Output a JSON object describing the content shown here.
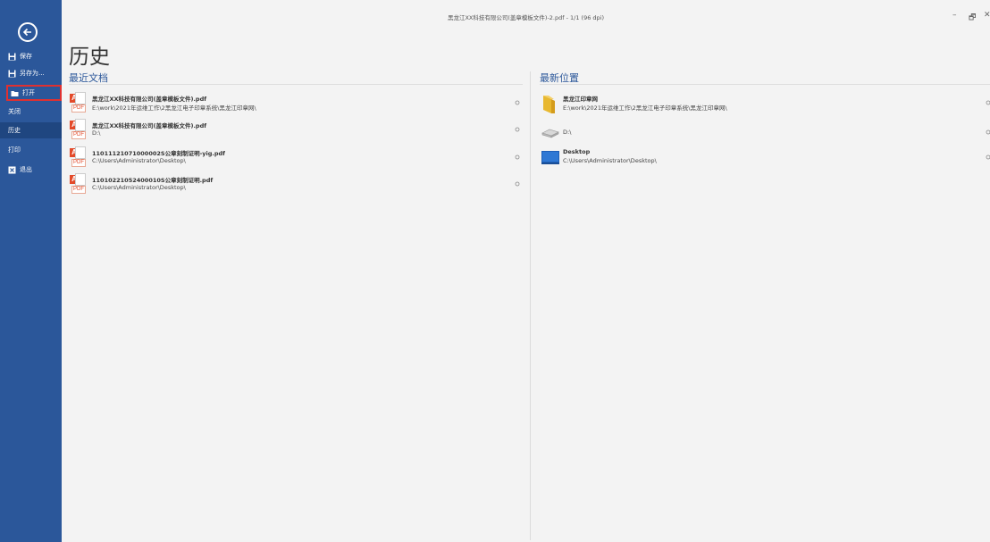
{
  "window": {
    "title": "黑龙江XX科技有限公司(盖章模板文件)-2.pdf - 1/1 (96 dpi)",
    "minimize": "–",
    "restore": "🗗",
    "close": "✕"
  },
  "sidebar": {
    "items": [
      {
        "label": "保存",
        "icon": "save-icon"
      },
      {
        "label": "另存为...",
        "icon": "save-as-icon"
      },
      {
        "label": "打开",
        "icon": "folder-open-icon"
      },
      {
        "label": "关闭",
        "icon": ""
      },
      {
        "label": "历史",
        "icon": ""
      },
      {
        "label": "打印",
        "icon": ""
      },
      {
        "label": "退出",
        "icon": "exit-icon"
      }
    ],
    "selected": "历史",
    "highlighted": "打开"
  },
  "main": {
    "title": "历史",
    "recent_docs": {
      "heading": "最近文档",
      "items": [
        {
          "name": "黑龙江XX科技有限公司(盖章模板文件).pdf",
          "path": "E:\\work\\2021年运维工作\\2黑龙江电子印章系统\\黑龙江印章网\\"
        },
        {
          "name": "黑龙江XX科技有限公司(盖章模板文件).pdf",
          "path": "D:\\"
        },
        {
          "name": "11011121071000002S公章刻制证明-yig.pdf",
          "path": "C:\\Users\\Administrator\\Desktop\\"
        },
        {
          "name": "11010221052400010S公章刻制证明.pdf",
          "path": "C:\\Users\\Administrator\\Desktop\\"
        }
      ]
    },
    "recent_locations": {
      "heading": "最新位置",
      "items": [
        {
          "name": "黑龙江印章网",
          "path": "E:\\work\\2021年运维工作\\2黑龙江电子印章系统\\黑龙江印章网\\",
          "icon": "folder-icon"
        },
        {
          "name": "",
          "path": "D:\\",
          "icon": "drive-icon"
        },
        {
          "name": "Desktop",
          "path": "C:\\Users\\Administrator\\Desktop\\",
          "icon": "desktop-icon"
        }
      ]
    }
  },
  "colors": {
    "sidebar": "#2b579a",
    "sidebar_selected": "#1f4680",
    "accent": "#2b579a",
    "highlight_border": "#e03030",
    "pdf_red": "#e34a2a"
  }
}
